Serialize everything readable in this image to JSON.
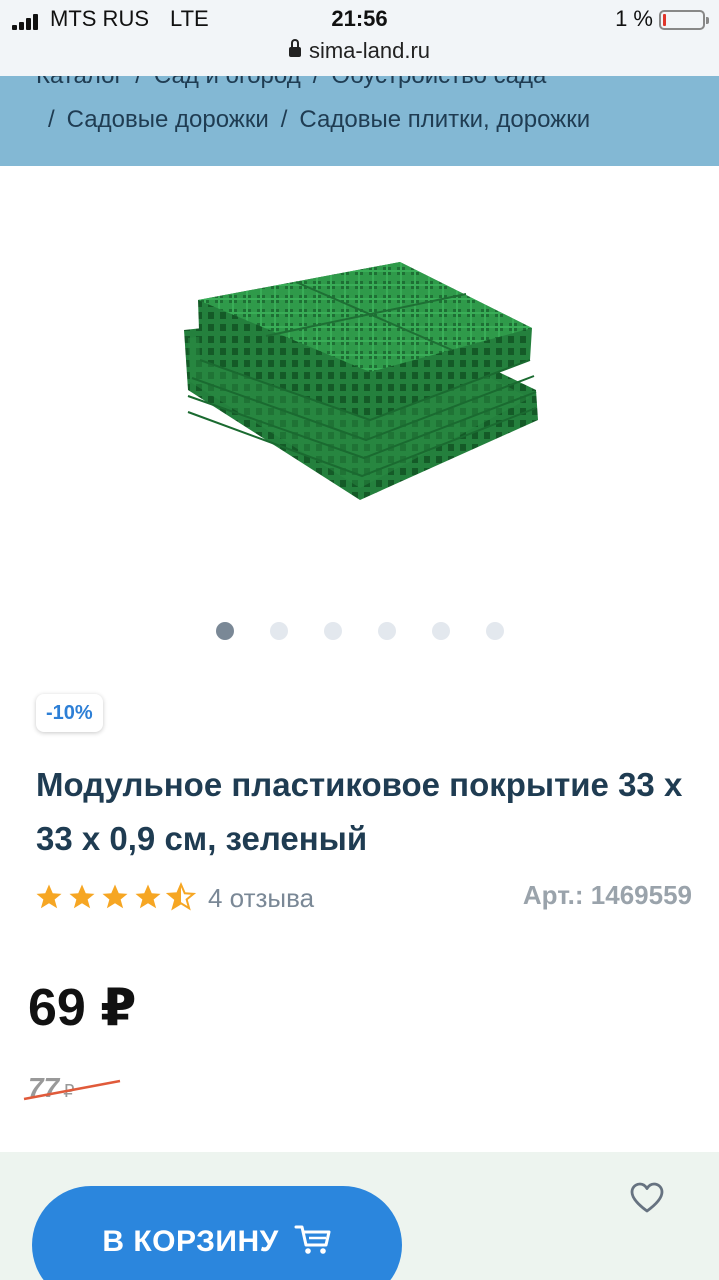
{
  "status_bar": {
    "carrier": "MTS RUS",
    "network": "LTE",
    "time": "21:56",
    "battery_percent": "1 %",
    "battery_level": 0.01,
    "url": "sima-land.ru"
  },
  "breadcrumbs": {
    "line1": [
      "Каталог",
      "Сад и огород",
      "Обустройство сада"
    ],
    "line2": [
      "Садовые дорожки",
      "Садовые плитки, дорожки"
    ],
    "separator": "/"
  },
  "gallery": {
    "image_icon": "green-plastic-tiles-image",
    "dot_count": 6,
    "active_index": 0
  },
  "product": {
    "discount": "-10%",
    "title": "Модульное пластиковое покрытие 33 х 33 х 0,9 см, зеленый",
    "rating": 4.5,
    "reviews": "4 отзыва",
    "article": "Арт.: 1469559",
    "price": "69 ₽",
    "old_price": "77",
    "old_price_currency": "₽"
  },
  "actions": {
    "add_to_cart": "В КОРЗИНУ",
    "cart_icon": "cart-icon",
    "favorite_icon": "heart-icon"
  },
  "colors": {
    "banner": "#83b8d4",
    "accent": "#2b86dd",
    "title": "#1f3c52",
    "star": "#f6a623",
    "footer": "#edf4ef",
    "strike": "#e05a3a"
  }
}
